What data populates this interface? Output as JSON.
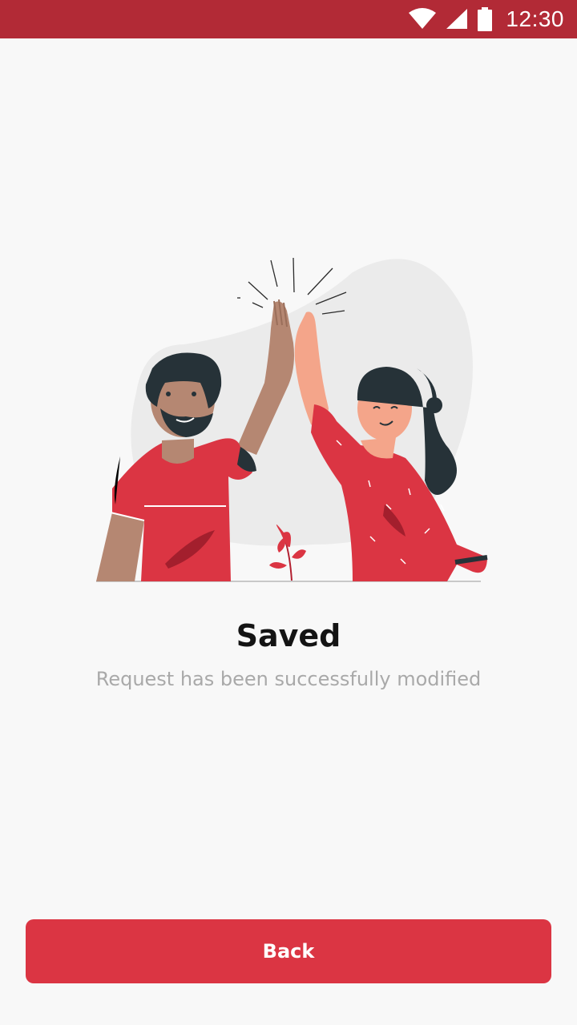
{
  "status_bar": {
    "time": "12:30",
    "icons": [
      "wifi-icon",
      "signal-icon",
      "battery-icon"
    ],
    "background": "#b22a36"
  },
  "illustration": {
    "icon": "high-five-illustration",
    "accent_color": "#db3543"
  },
  "message": {
    "title": "Saved",
    "subtitle": "Request has been successfully modified"
  },
  "actions": {
    "back_label": "Back"
  },
  "colors": {
    "primary": "#db3543",
    "background": "#f8f8f8",
    "title_text": "#141414",
    "subtitle_text": "#a9a9a9"
  }
}
